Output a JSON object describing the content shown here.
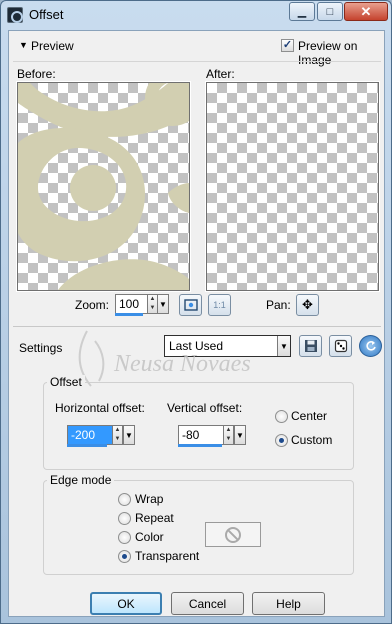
{
  "window": {
    "title": "Offset"
  },
  "titlebar_buttons": {
    "minimize": "▁",
    "maximize": "□",
    "close": "✕"
  },
  "preview": {
    "toggle_label": "Preview",
    "preview_on_image_label": "Preview on Image",
    "preview_on_image_checked": true,
    "checkmark": "✓",
    "before_label": "Before:",
    "after_label": "After:"
  },
  "zoom": {
    "label": "Zoom:",
    "value": "100",
    "fit_button_icon": "fit-window-icon",
    "one_to_one_label": "1:1"
  },
  "pan": {
    "label": "Pan:",
    "icon": "move-icon"
  },
  "settings": {
    "label": "Settings",
    "preset_value": "Last Used",
    "save_icon": "save-icon",
    "random_icon": "dice-icon",
    "reset_icon": "reset-icon"
  },
  "watermark": {
    "text": "Neusa Novaes"
  },
  "offset": {
    "group_title": "Offset",
    "horizontal_label": "Horizontal offset:",
    "horizontal_value": "-200",
    "vertical_label": "Vertical offset:",
    "vertical_value": "-80",
    "center_label": "Center",
    "custom_label": "Custom",
    "selected": "Custom"
  },
  "edge_mode": {
    "group_title": "Edge mode",
    "options": [
      "Wrap",
      "Repeat",
      "Color",
      "Transparent"
    ],
    "selected": "Transparent"
  },
  "buttons": {
    "ok": "OK",
    "cancel": "Cancel",
    "help": "Help"
  },
  "colors": {
    "shape": "#d2cfb1",
    "accent": "#3a8ee6",
    "window_frame": "#a9c3dc",
    "close_button": "#c5432e"
  }
}
